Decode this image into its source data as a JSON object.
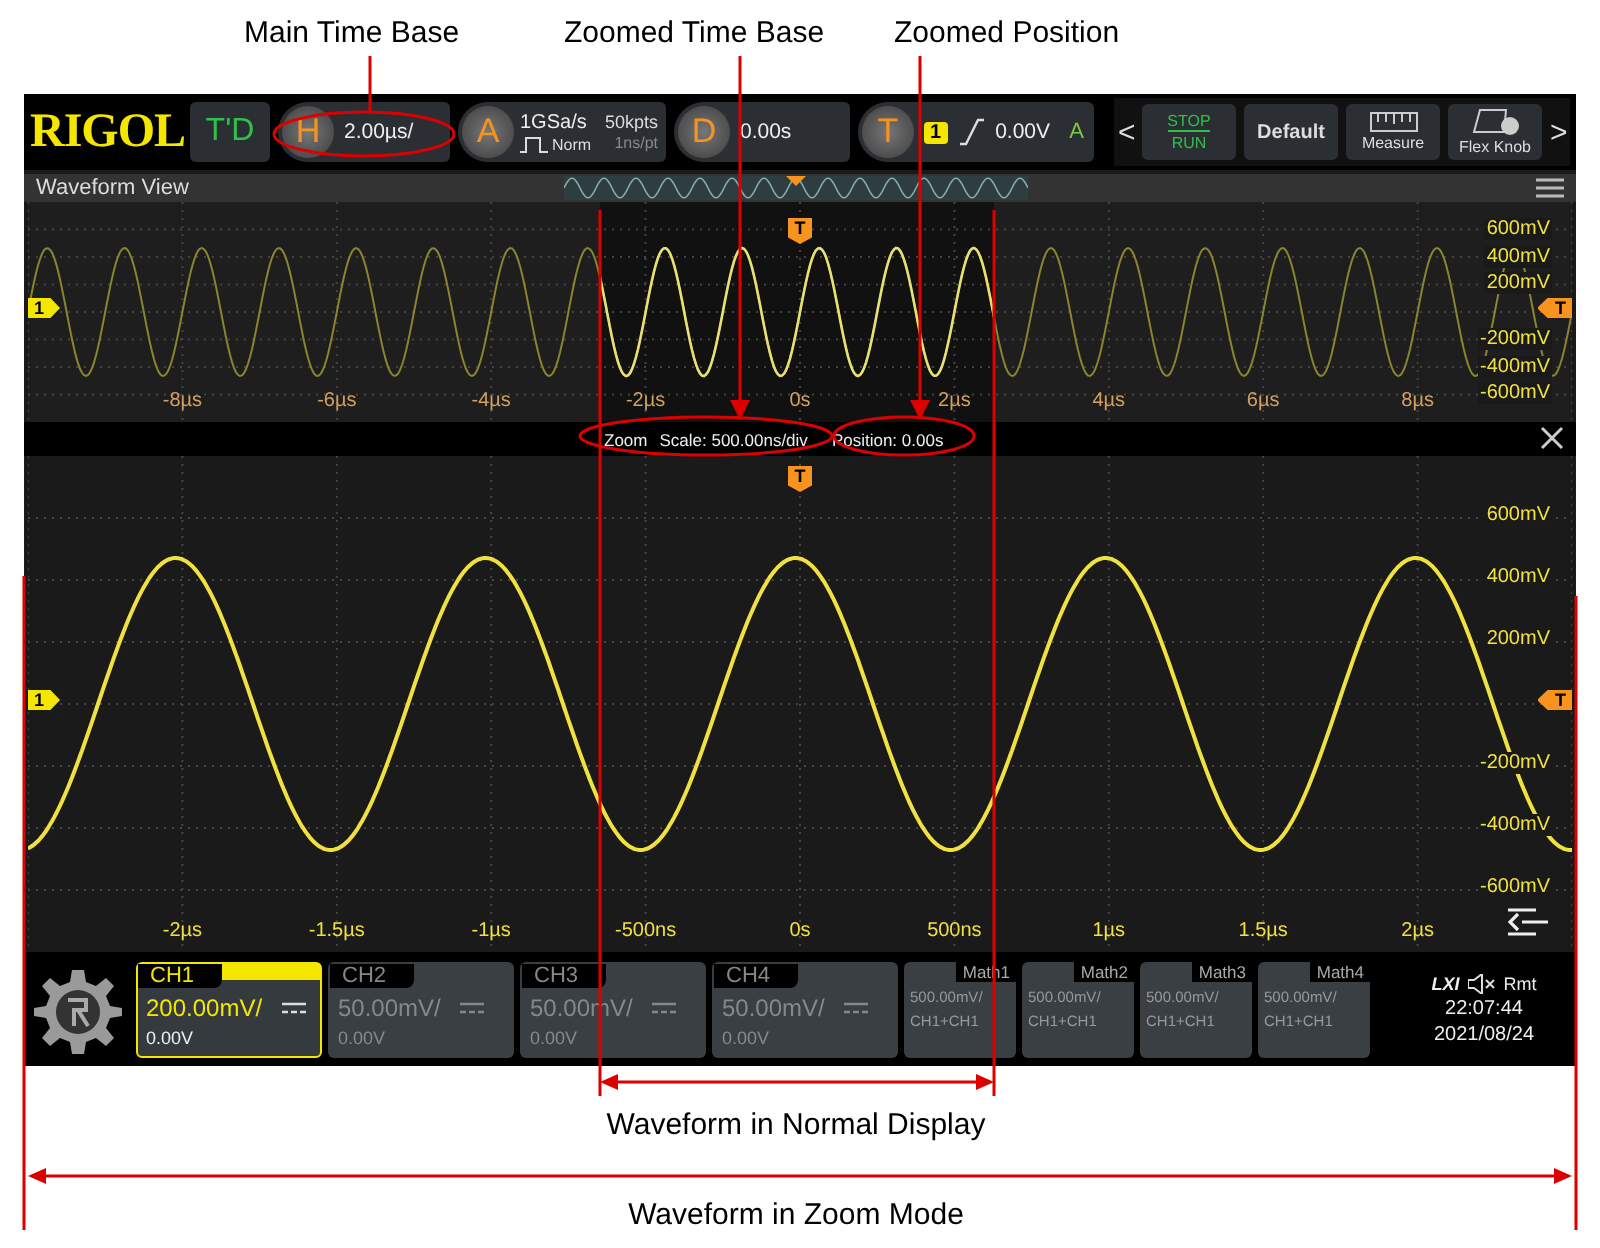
{
  "callouts": [
    "Main Time Base",
    "Zoomed Time Base",
    "Zoomed Position"
  ],
  "top_bar": {
    "logo": "RIGOL",
    "mode": "T'D",
    "horizontal": {
      "key": "H",
      "scale": "2.00µs/"
    },
    "acquire": {
      "key": "A",
      "sample_rate": "1GSa/s",
      "mode": "Norm",
      "depth": "50kpts",
      "resolution": "1ns/pt"
    },
    "delay": {
      "key": "D",
      "value": "0.00s"
    },
    "trigger": {
      "key": "T",
      "source": "1",
      "level": "0.00V",
      "sweep": "A"
    },
    "nav_prev": "<",
    "nav_next": ">",
    "buttons": [
      {
        "kind": "run",
        "top": "STOP",
        "bottom": "RUN"
      },
      {
        "kind": "plain",
        "label": "Default"
      },
      {
        "kind": "ruler",
        "label": "Measure"
      },
      {
        "kind": "knob",
        "label": "Flex Knob"
      }
    ]
  },
  "waveform_view": {
    "title": "Waveform View",
    "channel_marker": "1",
    "trigger_level_marker": "T",
    "trigger_position_marker": "T",
    "y_labels": [
      "600mV",
      "400mV",
      "200mV",
      "-200mV",
      "-400mV",
      "-600mV"
    ],
    "x_labels": [
      "-8µs",
      "-6µs",
      "-4µs",
      "-2µs",
      "0s",
      "2µs",
      "4µs",
      "6µs",
      "8µs"
    ]
  },
  "zoom_bar": {
    "title": "Zoom",
    "scale": "Scale: 500.00ns/div",
    "position": "Position: 0.00s"
  },
  "zoom_view": {
    "channel_marker": "1",
    "trigger_level_marker": "T",
    "trigger_position_marker": "T",
    "y_labels": [
      "600mV",
      "400mV",
      "200mV",
      "-200mV",
      "-400mV",
      "-600mV"
    ],
    "x_labels": [
      "-2µs",
      "-1.5µs",
      "-1µs",
      "-500ns",
      "0s",
      "500ns",
      "1µs",
      "1.5µs",
      "2µs"
    ]
  },
  "channels": [
    {
      "name": "CH1",
      "scale": "200.00mV/",
      "offset": "0.00V",
      "selected": true
    },
    {
      "name": "CH2",
      "scale": "50.00mV/",
      "offset": "0.00V",
      "selected": false
    },
    {
      "name": "CH3",
      "scale": "50.00mV/",
      "offset": "0.00V",
      "selected": false
    },
    {
      "name": "CH4",
      "scale": "50.00mV/",
      "offset": "0.00V",
      "selected": false
    }
  ],
  "math": [
    {
      "name": "Math1",
      "scale": "500.00mV/",
      "source": "CH1+CH1"
    },
    {
      "name": "Math2",
      "scale": "500.00mV/",
      "source": "CH1+CH1"
    },
    {
      "name": "Math3",
      "scale": "500.00mV/",
      "source": "CH1+CH1"
    },
    {
      "name": "Math4",
      "scale": "500.00mV/",
      "source": "CH1+CH1"
    }
  ],
  "status": {
    "lxi": "LXI",
    "remote": "Rmt",
    "time": "22:07:44",
    "date": "2021/08/24"
  },
  "captions": [
    "Waveform in Normal Display",
    "Waveform in Zoom Mode"
  ]
}
